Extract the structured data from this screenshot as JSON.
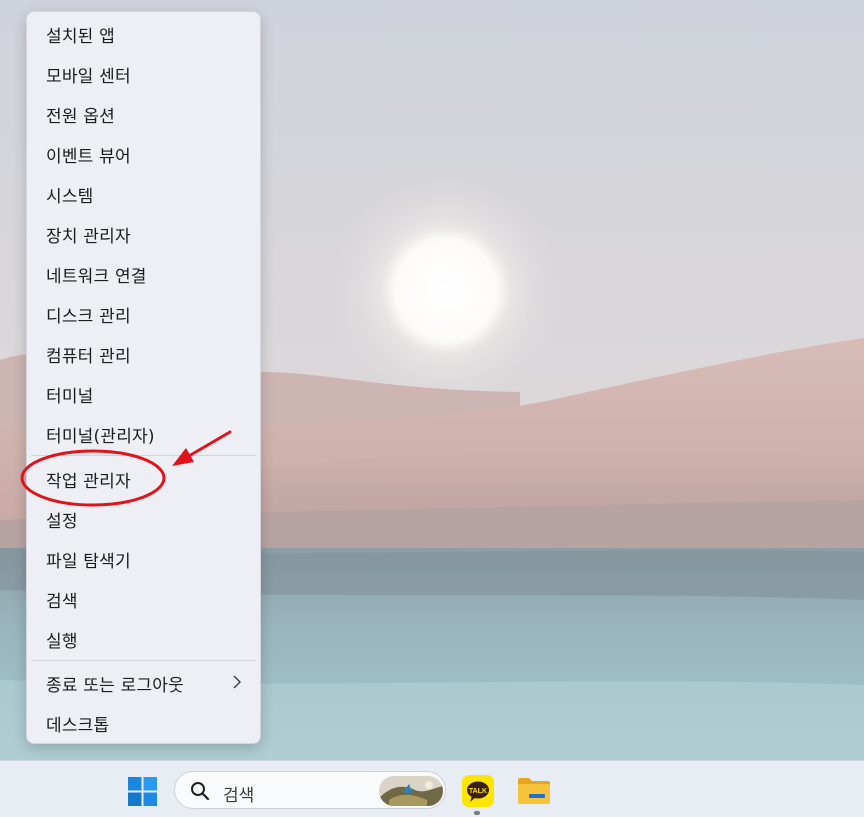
{
  "menu": {
    "items": [
      {
        "label": "설치된 앱"
      },
      {
        "label": "모바일 센터"
      },
      {
        "label": "전원 옵션"
      },
      {
        "label": "이벤트 뷰어"
      },
      {
        "label": "시스템"
      },
      {
        "label": "장치 관리자"
      },
      {
        "label": "네트워크 연결"
      },
      {
        "label": "디스크 관리"
      },
      {
        "label": "컴퓨터 관리"
      },
      {
        "label": "터미널"
      },
      {
        "label": "터미널(관리자)"
      },
      {
        "label": "작업 관리자"
      },
      {
        "label": "설정"
      },
      {
        "label": "파일 탐색기"
      },
      {
        "label": "검색"
      },
      {
        "label": "실행"
      },
      {
        "label": "종료 또는 로그아웃"
      },
      {
        "label": "데스크톱"
      }
    ]
  },
  "taskbar": {
    "search_placeholder": "검색",
    "apps": [
      {
        "icon": "windows-start-icon"
      },
      {
        "icon": "kakaotalk-icon",
        "label": "TALK",
        "running": true
      },
      {
        "icon": "file-explorer-icon"
      }
    ]
  },
  "annotation": {
    "highlight_color": "#e0131b",
    "highlighted_item": "작업 관리자"
  }
}
